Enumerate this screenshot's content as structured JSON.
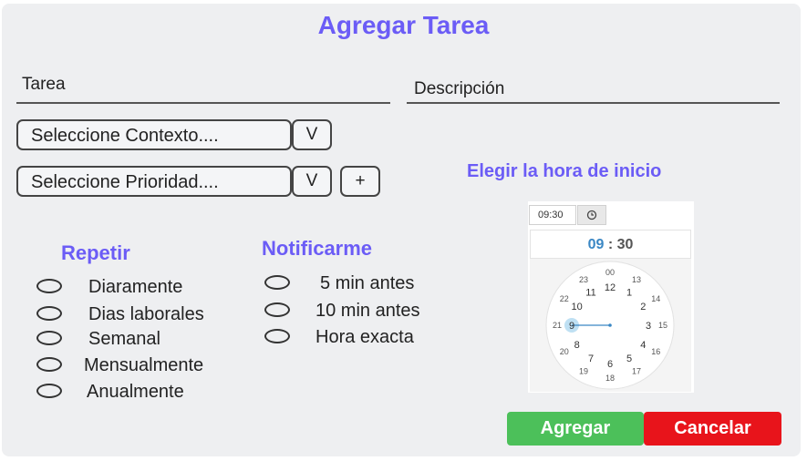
{
  "title": "Agregar Tarea",
  "fields": {
    "tarea_label": "Tarea",
    "descripcion_label": "Descripción"
  },
  "selects": {
    "contexto_placeholder": "Seleccione Contexto....",
    "prioridad_placeholder": "Seleccione Prioridad....",
    "dropdown_label": "V",
    "add_label": "+"
  },
  "repetir": {
    "title": "Repetir",
    "options": [
      "Diaramente",
      "Dias laborales",
      "Semanal",
      "Mensualmente",
      "Anualmente"
    ]
  },
  "notificarme": {
    "title": "Notificarme",
    "options": [
      "5 min antes",
      "10 min antes",
      "Hora exacta"
    ]
  },
  "start_time": {
    "title": "Elegir la hora de inicio",
    "input_value": "09:30",
    "hour": "09",
    "separator": ":",
    "minute": "30",
    "selected_hour": 9,
    "outer_hours": [
      "00",
      "13",
      "14",
      "15",
      "16",
      "17",
      "18",
      "19",
      "20",
      "21",
      "22",
      "23"
    ],
    "inner_hours": [
      "12",
      "1",
      "2",
      "3",
      "4",
      "5",
      "6",
      "7",
      "8",
      "9",
      "10",
      "11"
    ],
    "accent_color": "#3a87c4"
  },
  "buttons": {
    "agregar": "Agregar",
    "cancelar": "Cancelar"
  },
  "colors": {
    "title": "#6b5cf6",
    "agregar": "#4cc05a",
    "cancelar": "#e8141b"
  }
}
